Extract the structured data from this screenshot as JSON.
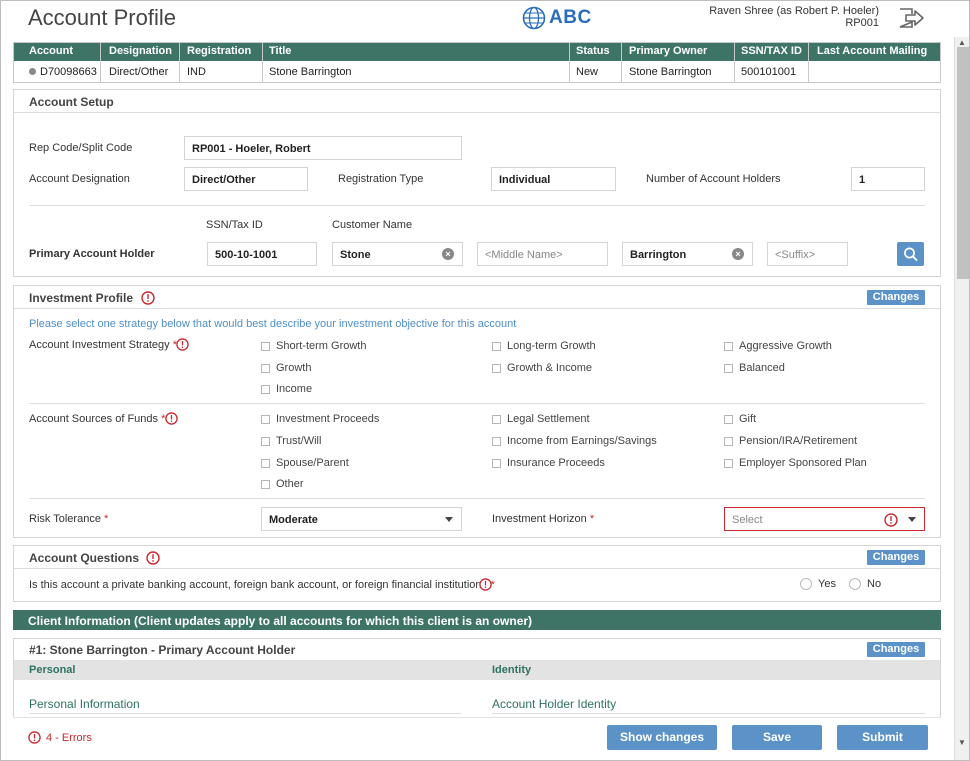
{
  "header": {
    "title": "Account Profile",
    "logo_text": "ABC",
    "user_line1": "Raven Shree (as Robert P. Hoeler)",
    "user_line2": "RP001"
  },
  "account_table": {
    "columns": [
      "Account",
      "Designation",
      "Registration",
      "Title",
      "Status",
      "Primary Owner",
      "SSN/TAX ID",
      "Last Account Mailing"
    ],
    "row": [
      "D70098663",
      "Direct/Other",
      "IND",
      "Stone Barrington",
      "New",
      "Stone Barrington",
      "500101001",
      ""
    ]
  },
  "account_setup": {
    "title": "Account Setup",
    "rep_code_label": "Rep Code/Split Code",
    "rep_code_value": "RP001 - Hoeler, Robert",
    "designation_label": "Account Designation",
    "designation_value": "Direct/Other",
    "registration_label": "Registration Type",
    "registration_value": "Individual",
    "holders_label": "Number of Account Holders",
    "holders_value": "1",
    "ssn_col_label": "SSN/Tax ID",
    "customer_col_label": "Customer Name",
    "primary_label": "Primary Account Holder",
    "ssn_value": "500-10-1001",
    "first_name": "Stone",
    "middle_placeholder": "<Middle Name>",
    "last_name": "Barrington",
    "suffix_placeholder": "<Suffix>"
  },
  "investment_profile": {
    "title": "Investment Profile",
    "changes_label": "Changes",
    "hint": "Please select one strategy below that would best describe your investment objective for this account",
    "strategy_label": "Account Investment Strategy",
    "strategies": [
      "Short-term Growth",
      "Long-term Growth",
      "Aggressive Growth",
      "Growth",
      "Growth & Income",
      "Balanced",
      "Income"
    ],
    "sources_label": "Account Sources of Funds",
    "sources": [
      "Investment Proceeds",
      "Legal Settlement",
      "Gift",
      "Trust/Will",
      "Income from Earnings/Savings",
      "Pension/IRA/Retirement",
      "Spouse/Parent",
      "Insurance Proceeds",
      "Employer Sponsored Plan",
      "Other"
    ],
    "risk_label": "Risk Tolerance",
    "risk_value": "Moderate",
    "horizon_label": "Investment Horizon",
    "horizon_placeholder": "Select",
    "required_mark": "*"
  },
  "account_questions": {
    "title": "Account Questions",
    "changes_label": "Changes",
    "question": "Is this account a private banking account, foreign bank account, or foreign financial institution?",
    "yes_label": "Yes",
    "no_label": "No"
  },
  "client_information": {
    "bar_title": "Client Information (Client updates apply to all accounts for which this client is an owner)",
    "holder_title": "#1: Stone Barrington - Primary Account Holder",
    "changes_label": "Changes",
    "personal_tab": "Personal",
    "identity_tab": "Identity",
    "personal_info": "Personal Information",
    "holder_identity": "Account Holder Identity"
  },
  "footer": {
    "errors": "4 - Errors",
    "show_changes": "Show changes",
    "save": "Save",
    "submit": "Submit"
  },
  "colors": {
    "brand_green": "#3e7466",
    "button_blue": "#5b92c8",
    "error_red": "#c8282e",
    "hint_blue": "#4f8fc7"
  }
}
